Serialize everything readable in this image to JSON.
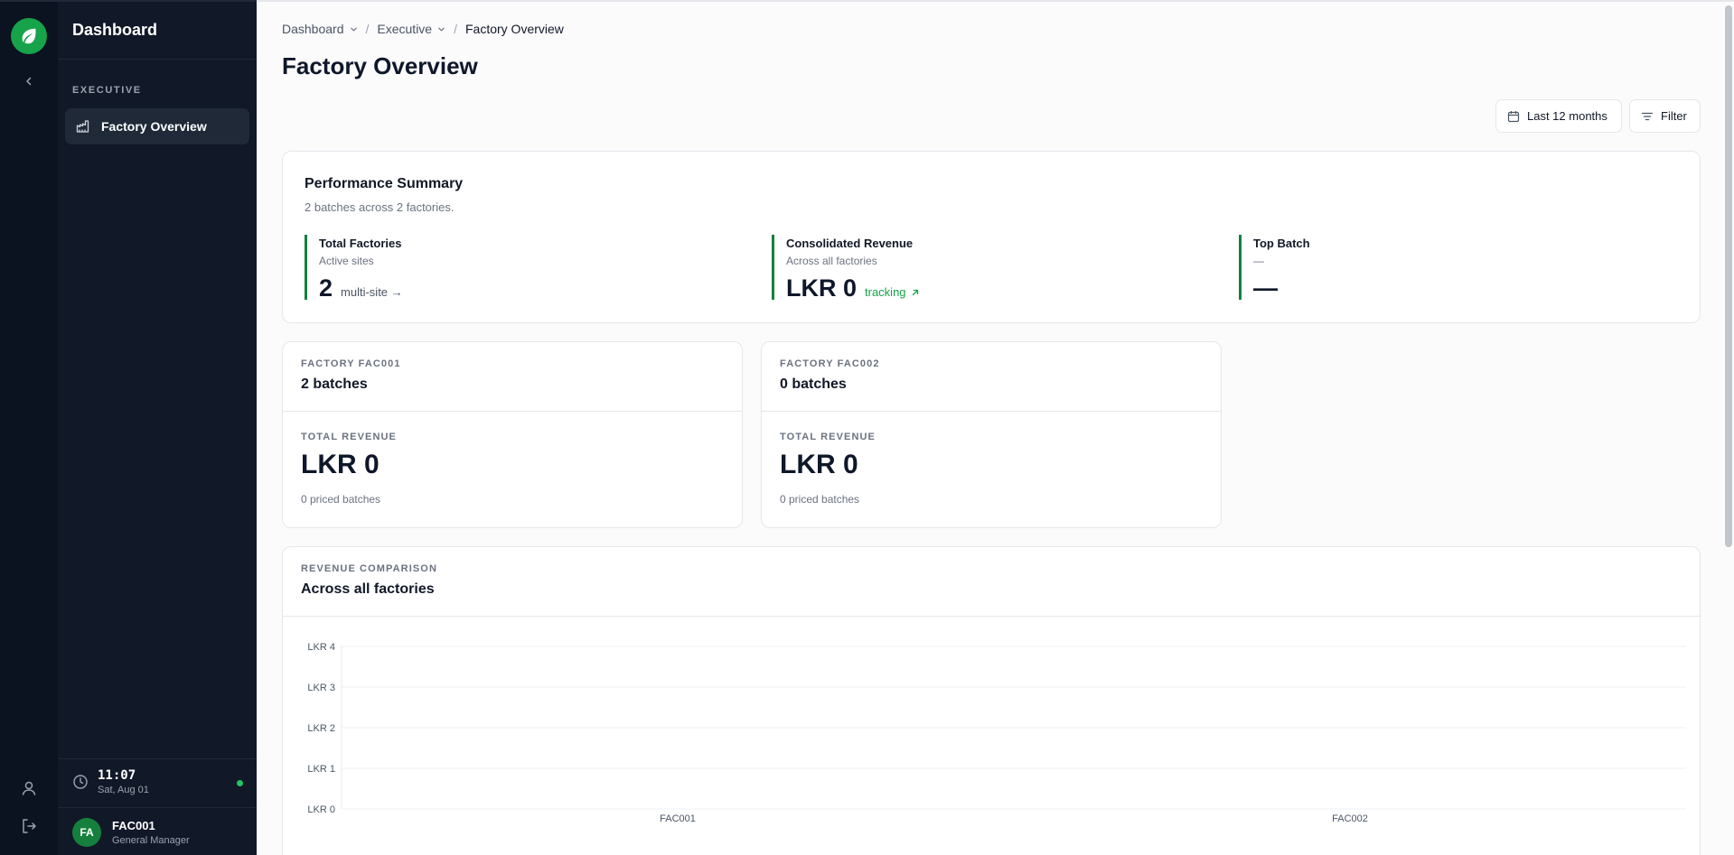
{
  "colors": {
    "accent": "#16a34a",
    "rail_bg": "#0b1220",
    "sidebar_bg": "#111827"
  },
  "icons": {
    "logo": "leaf-icon",
    "collapse": "chevron-left-icon",
    "user": "user-icon",
    "logout": "logout-icon",
    "nav": "factory-icon",
    "clock": "clock-icon",
    "date": "calendar-icon",
    "filter": "filter-icon"
  },
  "sidebar": {
    "title": "Dashboard",
    "section": "EXECUTIVE",
    "items": [
      {
        "label": "Factory Overview"
      }
    ],
    "clock": {
      "time": "11:07",
      "date": "Sat, Aug 01"
    },
    "profile": {
      "initials": "FA",
      "name": "FAC001",
      "role": "General Manager"
    }
  },
  "breadcrumb": {
    "items": [
      "Dashboard",
      "Executive"
    ],
    "current": "Factory Overview"
  },
  "page": {
    "title": "Factory Overview"
  },
  "toolbar": {
    "date_range": "Last 12 months",
    "filter": "Filter"
  },
  "summary": {
    "title": "Performance Summary",
    "subtitle": "2 batches across 2 factories.",
    "stats": [
      {
        "title": "Total Factories",
        "subtitle": "Active sites",
        "value": "2",
        "note": "multi-site →"
      },
      {
        "title": "Consolidated Revenue",
        "subtitle": "Across all factories",
        "value": "LKR 0",
        "note": "tracking"
      },
      {
        "title": "Top Batch",
        "subtitle": "—",
        "value": "—",
        "note": ""
      }
    ]
  },
  "factories": [
    {
      "label": "FACTORY FAC001",
      "batches": "2 batches",
      "revenue_label": "TOTAL REVENUE",
      "revenue": "LKR 0",
      "priced": "0 priced batches"
    },
    {
      "label": "FACTORY FAC002",
      "batches": "0 batches",
      "revenue_label": "TOTAL REVENUE",
      "revenue": "LKR 0",
      "priced": "0 priced batches"
    }
  ],
  "revenue_chart": {
    "label": "REVENUE COMPARISON",
    "title": "Across all factories"
  },
  "chart_data": {
    "type": "bar",
    "categories": [
      "FAC001",
      "FAC002"
    ],
    "values": [
      0,
      0
    ],
    "ylim": [
      0,
      4
    ],
    "yticks": [
      "LKR 0",
      "LKR 1",
      "LKR 2",
      "LKR 3",
      "LKR 4"
    ],
    "grid": true
  }
}
